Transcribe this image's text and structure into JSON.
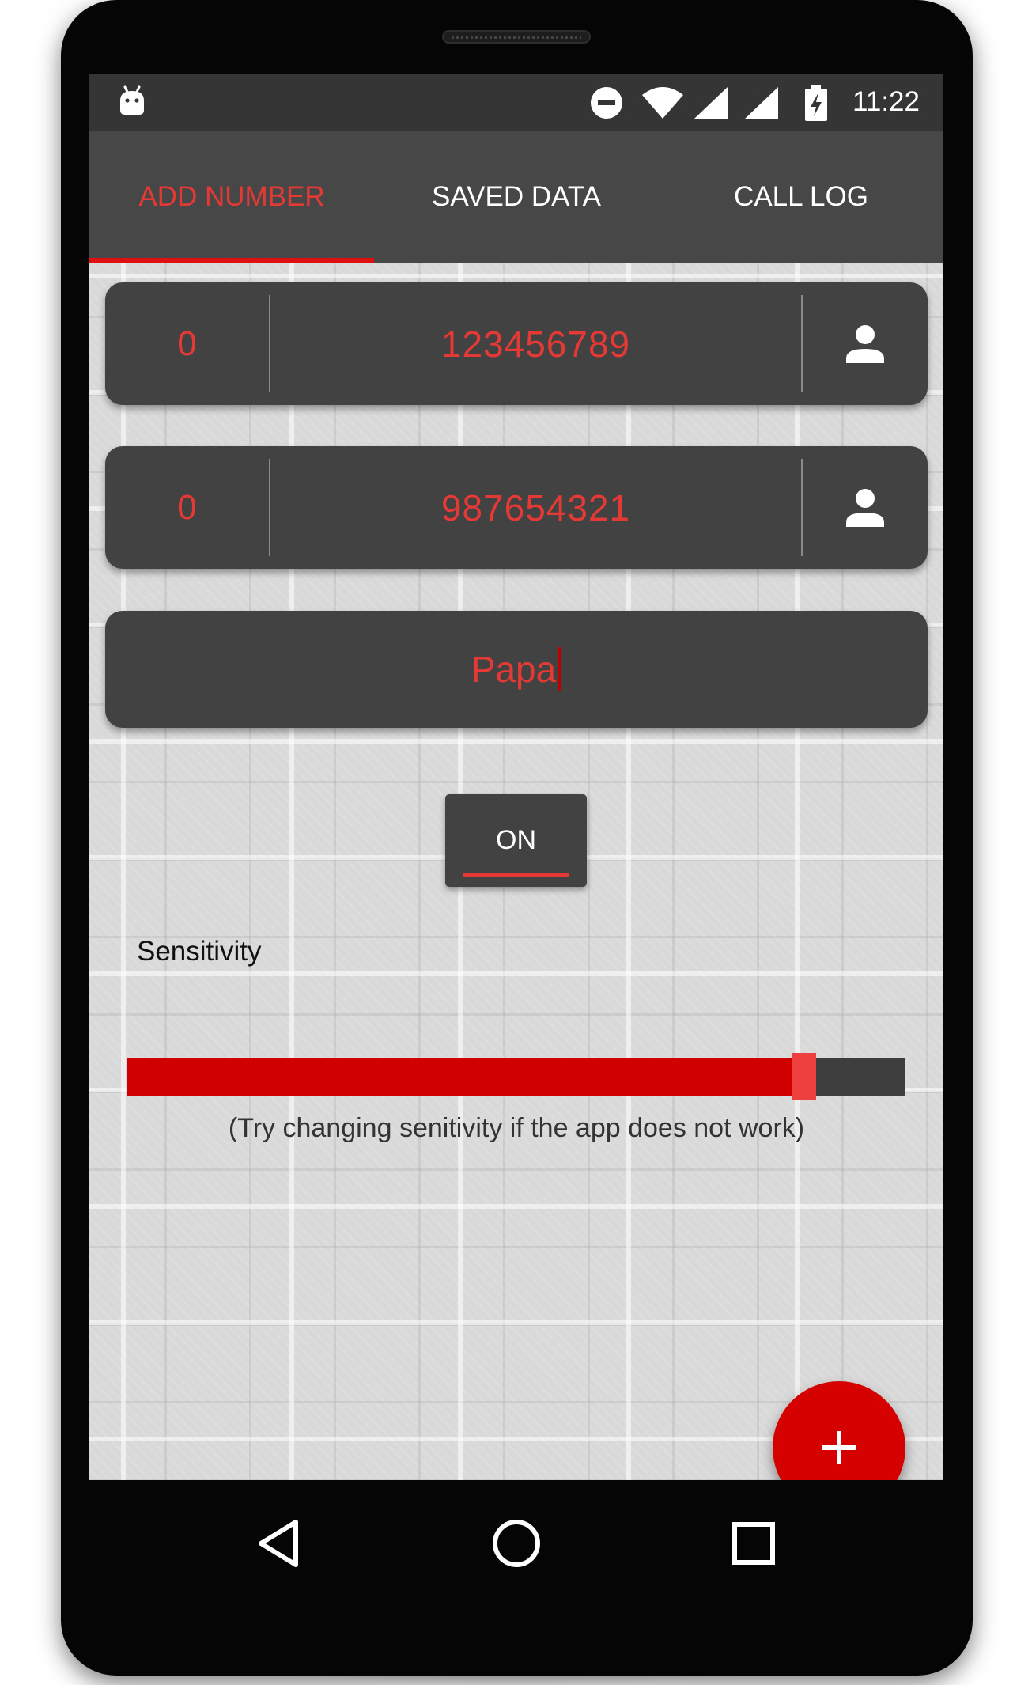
{
  "status_bar": {
    "time": "11:22",
    "icons": [
      "android-icon",
      "do-not-disturb-icon",
      "wifi-icon",
      "cell-signal-icon",
      "cell-signal-icon",
      "battery-charging-icon"
    ]
  },
  "tabs": [
    {
      "label": "ADD NUMBER",
      "active": true
    },
    {
      "label": "SAVED DATA",
      "active": false
    },
    {
      "label": "CALL LOG",
      "active": false
    }
  ],
  "numbers": [
    {
      "prefix": "0",
      "value": "123456789",
      "contact_icon": "person-icon"
    },
    {
      "prefix": "0",
      "value": "987654321",
      "contact_icon": "person-icon"
    }
  ],
  "name_field": {
    "value": "Papa"
  },
  "toggle": {
    "label": "ON",
    "state": "on"
  },
  "sensitivity": {
    "label": "Sensitivity",
    "value": 0.87,
    "hint": "(Try changing senitivity if the app does not work)"
  },
  "fab": {
    "icon": "plus-icon"
  },
  "nav": {
    "back": "back-icon",
    "home": "home-icon",
    "recents": "recents-icon"
  },
  "colors": {
    "accent": "#e53935",
    "fab": "#d50000",
    "card": "#424242",
    "tabbar": "#474747",
    "statusbar": "#353535"
  }
}
